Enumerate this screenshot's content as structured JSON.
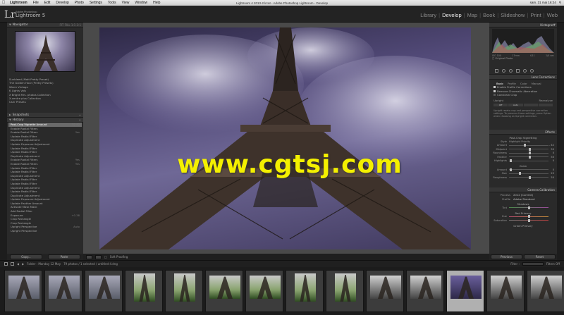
{
  "menubar": {
    "apple": "",
    "app_name": "Lightroom",
    "items": [
      "File",
      "Edit",
      "Develop",
      "Photo",
      "Settings",
      "Tools",
      "View",
      "Window",
      "Help"
    ],
    "window_title": "Lightroom 4 2013-2.lrcat - Adobe Photoshop Lightroom - Develop",
    "clock": "sam. 31 mai 16:24"
  },
  "identity": {
    "logo": "Lr",
    "brand_small": "Adobe Photoshop",
    "brand_big": "Lightroom 5"
  },
  "modules": [
    "Library",
    "Develop",
    "Map",
    "Book",
    "Slideshow",
    "Print",
    "Web"
  ],
  "active_module": "Develop",
  "left_panel": {
    "navigator": {
      "title": "Navigator",
      "zoom_options": "FIT  FILL  1:1  3:1"
    },
    "presets": [
      "Sunbleed (Matt Pretty Preset)",
      "The Golden Hour (Pretty Presets)",
      "Warm Vintage",
      "K Lights Vols",
      "X Bright Mrs. photos Collection",
      "X-centre plus Collection",
      "User Presets"
    ],
    "snapshots": {
      "title": "Snapshots"
    },
    "history": {
      "title": "History",
      "items": [
        {
          "label": "Post-Crop Vignette Amount",
          "value": "32   42"
        },
        {
          "label": "Enable Radial Filters",
          "value": ""
        },
        {
          "label": "Enable Radial Filters",
          "value": "Yes"
        },
        {
          "label": "Update Radial Filter",
          "value": ""
        },
        {
          "label": "Duplicate Adjustment",
          "value": ""
        },
        {
          "label": "Update Exposure Adjustment",
          "value": ""
        },
        {
          "label": "Update Radial Filter",
          "value": ""
        },
        {
          "label": "Update Radial Filter",
          "value": ""
        },
        {
          "label": "Duplicate Adjustment",
          "value": ""
        },
        {
          "label": "Enable Radial Filters",
          "value": "Yes"
        },
        {
          "label": "Enable Radial Filters",
          "value": "Yes"
        },
        {
          "label": "Update Radial Filter",
          "value": ""
        },
        {
          "label": "Update Radial Filter",
          "value": ""
        },
        {
          "label": "Duplicate Adjustment",
          "value": ""
        },
        {
          "label": "Update Radial Filter",
          "value": ""
        },
        {
          "label": "Update Radial Filter",
          "value": ""
        },
        {
          "label": "Duplicate Adjustment",
          "value": ""
        },
        {
          "label": "Update Radial Filter",
          "value": ""
        },
        {
          "label": "Duplicate Adjustment",
          "value": ""
        },
        {
          "label": "Update Exposure Adjustment",
          "value": ""
        },
        {
          "label": "Update Feather Amount",
          "value": ""
        },
        {
          "label": "Activate Mask Mask",
          "value": ""
        },
        {
          "label": "Add Radial Filter",
          "value": ""
        },
        {
          "label": "Exposure",
          "value": "+0.38"
        },
        {
          "label": "Crop Rectangle",
          "value": ""
        },
        {
          "label": "Crop Rectangle",
          "value": ""
        },
        {
          "label": "Upright Perspective",
          "value": "Auto"
        },
        {
          "label": "Upright Perspective",
          "value": ""
        }
      ]
    },
    "copy_label": "Copy...",
    "paste_label": "Paste"
  },
  "toolbar": {
    "soft_proofing": "Soft Proofing"
  },
  "watermark": "www.cgtsj.com",
  "right_panel": {
    "histogram": {
      "title": "Histogram",
      "values": [
        "ISO 100",
        "17mm",
        "f/11",
        "1/4 sec"
      ],
      "original_photo": "Original Photo"
    },
    "lens": {
      "title": "Lens Corrections",
      "tabs": [
        "Basic",
        "Profile",
        "Color",
        "Manual"
      ],
      "active_tab": "Basic",
      "checks": [
        {
          "label": "Enable Profile Corrections",
          "on": true
        },
        {
          "label": "Remove Chromatic Aberration",
          "on": true
        },
        {
          "label": "Constrain Crop",
          "on": false
        }
      ],
      "upright_label": "Upright",
      "reanalyze_label": "Reanalyze",
      "upright_off": "Off",
      "upright_auto": "Auto",
      "note": "Upright resets crop and perspective correction settings. To preserve these settings, press Option when choosing an Upright correction."
    },
    "effects": {
      "title": "Effects",
      "vignette_title": "Post-Crop Vignetting",
      "style_label": "Style",
      "style_value": "Highlight Priority",
      "sliders": [
        {
          "label": "Amount",
          "value": "- 42",
          "level": 0.38
        },
        {
          "label": "Midpoint",
          "value": "50",
          "level": 0.5
        },
        {
          "label": "Roundness",
          "value": "0",
          "level": 0.5
        },
        {
          "label": "Feather",
          "value": "50",
          "level": 0.5
        },
        {
          "label": "Highlights",
          "value": "0",
          "level": 0.02
        }
      ],
      "grain_title": "Grain",
      "grain_sliders": [
        {
          "label": "Amount",
          "value": "0",
          "level": 0.02
        },
        {
          "label": "Size",
          "value": "25",
          "level": 0.25
        },
        {
          "label": "Roughness",
          "value": "50",
          "level": 0.5
        }
      ]
    },
    "camera": {
      "title": "Camera Calibration",
      "process_label": "Process",
      "process_value": "2012 (Current)",
      "profile_label": "Profile",
      "profile_value": "Adobe Standard",
      "shadows_title": "Shadows",
      "tint_label": "Tint",
      "red_primary": "Red Primary",
      "hue_label": "Hue",
      "saturation_label": "Saturation",
      "green_primary": "Green Primary"
    },
    "previous_label": "Previous",
    "reset_label": "Reset"
  },
  "filmstrip_bar": {
    "folder_text": "Folder : Monday 12 May",
    "count_text": "79 photos / 1 selected / untitled-4.dng",
    "filter_label": "Filter :",
    "filter_value": "Filters Off"
  }
}
